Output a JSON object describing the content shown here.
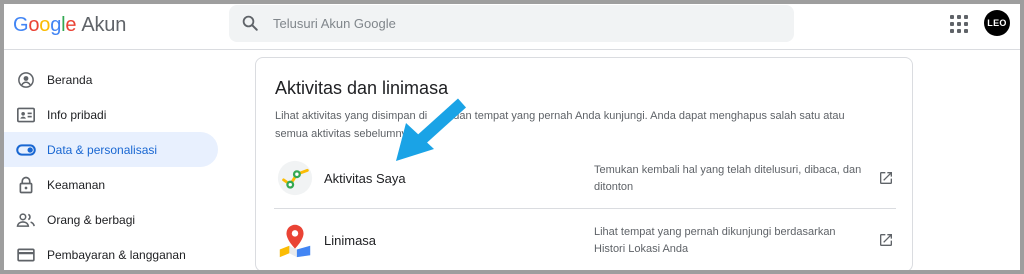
{
  "header": {
    "logo_google": [
      "G",
      "o",
      "o",
      "g",
      "l",
      "e"
    ],
    "logo_product": "Akun",
    "search_placeholder": "Telusuri Akun Google",
    "apps_icon": "apps-grid-icon",
    "avatar_text": "LEO"
  },
  "sidebar": {
    "items": [
      {
        "label": "Beranda",
        "icon": "account-circle-icon",
        "active": false
      },
      {
        "label": "Info pribadi",
        "icon": "id-card-icon",
        "active": false
      },
      {
        "label": "Data & personalisasi",
        "icon": "toggle-icon",
        "active": true
      },
      {
        "label": "Keamanan",
        "icon": "lock-icon",
        "active": false
      },
      {
        "label": "Orang & berbagi",
        "icon": "people-icon",
        "active": false
      },
      {
        "label": "Pembayaran & langganan",
        "icon": "credit-card-icon",
        "active": false
      }
    ]
  },
  "card": {
    "title": "Aktivitas dan linimasa",
    "desc_part1": "Lihat aktivitas yang disimpan di",
    "desc_part2": "dan tempat yang pernah Anda kunjungi. Anda dapat menghapus salah satu atau",
    "desc_part3": "semua aktivitas sebelumny",
    "rows": [
      {
        "title": "Aktivitas Saya",
        "desc": "Temukan kembali hal yang telah ditelusuri, dibaca, dan ditonton",
        "icon": "my-activity-icon"
      },
      {
        "title": "Linimasa",
        "desc": "Lihat tempat yang pernah dikunjungi berdasarkan Histori Lokasi Anda",
        "icon": "map-pin-icon"
      }
    ]
  },
  "colors": {
    "accent": "#1a73e8",
    "active_bg": "#e8f0fe",
    "annotation_arrow": "#1aa3e6"
  }
}
